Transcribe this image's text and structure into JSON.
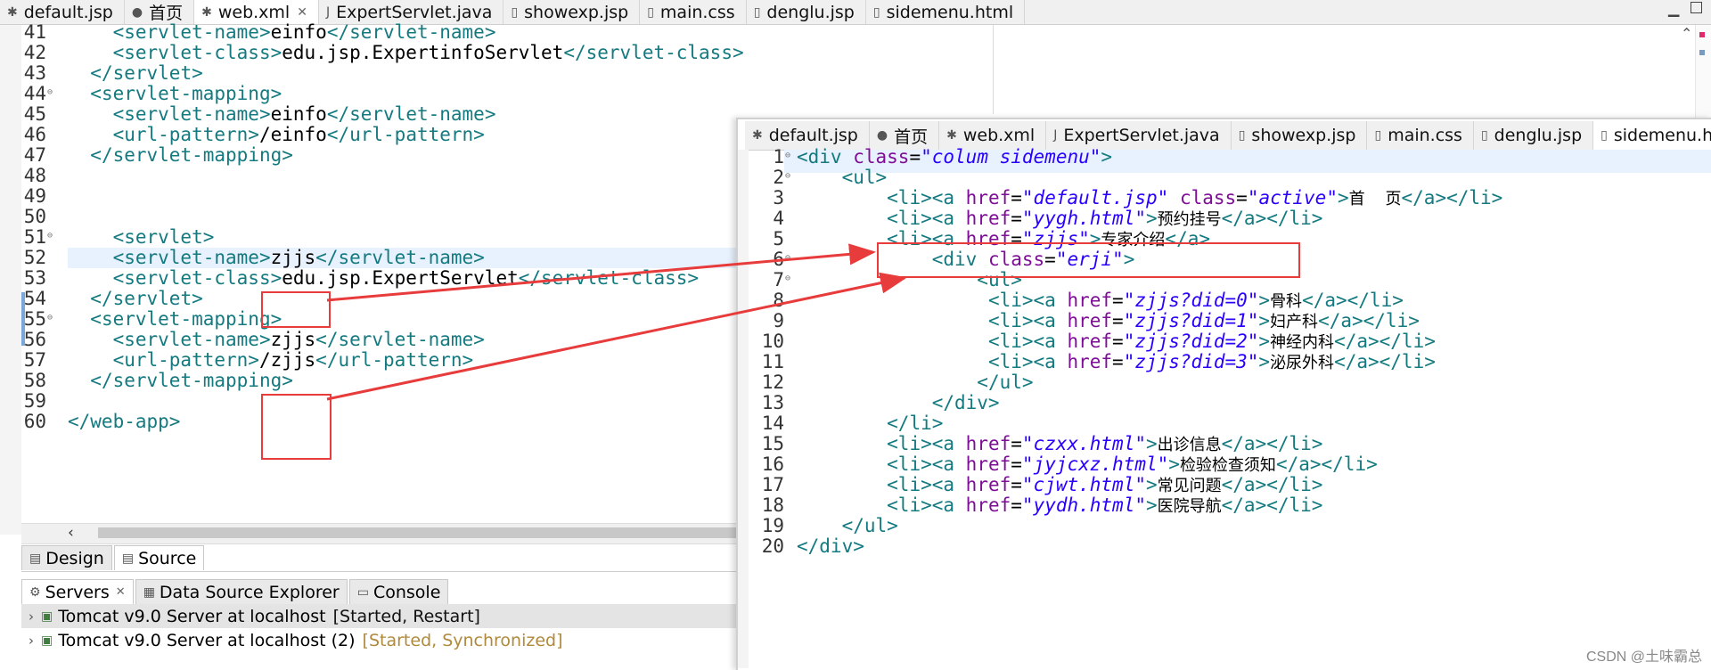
{
  "left_tabs": [
    {
      "icon": "xml-file-icon",
      "label": "default.jsp",
      "active": false
    },
    {
      "icon": "globe-icon",
      "label": "首页",
      "active": false
    },
    {
      "icon": "xml-file-icon",
      "label": "web.xml",
      "active": true,
      "close": "✕"
    },
    {
      "icon": "java-file-icon",
      "label": "ExpertServlet.java",
      "active": false
    },
    {
      "icon": "jsp-file-icon",
      "label": "showexp.jsp",
      "active": false
    },
    {
      "icon": "css-file-icon",
      "label": "main.css",
      "active": false
    },
    {
      "icon": "jsp-file-icon",
      "label": "denglu.jsp",
      "active": false
    },
    {
      "icon": "html-file-icon",
      "label": "sidemenu.html",
      "active": false
    }
  ],
  "left_code": [
    {
      "n": "41",
      "html": "    <span class='t'>&lt;servlet-name&gt;</span><span class='k'>einfo</span><span class='t'>&lt;/servlet-name&gt;</span>"
    },
    {
      "n": "42",
      "html": "    <span class='t'>&lt;servlet-class&gt;</span><span class='k'>edu.jsp.ExpertinfoServlet</span><span class='t'>&lt;/servlet-class&gt;</span>"
    },
    {
      "n": "43",
      "html": "  <span class='t'>&lt;/servlet&gt;</span>"
    },
    {
      "n": "44",
      "fold": true,
      "html": "  <span class='t'>&lt;servlet-mapping&gt;</span>"
    },
    {
      "n": "45",
      "html": "    <span class='t'>&lt;servlet-name&gt;</span><span class='k'>einfo</span><span class='t'>&lt;/servlet-name&gt;</span>"
    },
    {
      "n": "46",
      "html": "    <span class='t'>&lt;url-pattern&gt;</span><span class='k'>/einfo</span><span class='t'>&lt;/url-pattern&gt;</span>"
    },
    {
      "n": "47",
      "html": "  <span class='t'>&lt;/servlet-mapping&gt;</span>"
    },
    {
      "n": "48",
      "html": ""
    },
    {
      "n": "49",
      "html": ""
    },
    {
      "n": "50",
      "html": ""
    },
    {
      "n": "51",
      "fold": true,
      "html": "    <span class='t'>&lt;servlet&gt;</span>"
    },
    {
      "n": "52",
      "current": true,
      "html": "    <span class='t'>&lt;servlet-name&gt;</span><span class='k'>zjjs</span><span class='t'>&lt;/servlet-name&gt;</span>"
    },
    {
      "n": "53",
      "html": "    <span class='t'>&lt;servlet-class&gt;</span><span class='k'>edu.jsp.ExpertServlet</span><span class='t'>&lt;/servlet-class&gt;</span>"
    },
    {
      "n": "54",
      "html": "  <span class='t'>&lt;/servlet&gt;</span>"
    },
    {
      "n": "55",
      "fold": true,
      "html": "  <span class='t'>&lt;servlet-mapping&gt;</span>"
    },
    {
      "n": "56",
      "html": "    <span class='t'>&lt;servlet-name&gt;</span><span class='k'>zjjs</span><span class='t'>&lt;/servlet-name&gt;</span>"
    },
    {
      "n": "57",
      "html": "    <span class='t'>&lt;url-pattern&gt;</span><span class='k'>/zjjs</span><span class='t'>&lt;/url-pattern&gt;</span>"
    },
    {
      "n": "58",
      "html": "  <span class='t'>&lt;/servlet-mapping&gt;</span>"
    },
    {
      "n": "59",
      "html": ""
    },
    {
      "n": "60",
      "html": "<span class='t'>&lt;/web-app&gt;</span>"
    }
  ],
  "editor_mode_tabs": [
    {
      "icon": "design-icon",
      "label": "Design"
    },
    {
      "icon": "source-icon",
      "label": "Source"
    }
  ],
  "view_tabs": [
    {
      "icon": "servers-icon",
      "label": "Servers",
      "close": "✕"
    },
    {
      "icon": "database-icon",
      "label": "Data Source Explorer"
    },
    {
      "icon": "console-icon",
      "label": "Console"
    }
  ],
  "servers": [
    {
      "name": "Tomcat v9.0 Server at localhost",
      "status": "[Started, Restart]"
    },
    {
      "name": "Tomcat v9.0 Server at localhost (2)",
      "status": "[Started, Synchronized]"
    }
  ],
  "right_tabs": [
    {
      "icon": "xml-file-icon",
      "label": "default.jsp",
      "active": false
    },
    {
      "icon": "globe-icon",
      "label": "首页",
      "active": false
    },
    {
      "icon": "xml-file-icon",
      "label": "web.xml",
      "active": false
    },
    {
      "icon": "java-file-icon",
      "label": "ExpertServlet.java",
      "active": false
    },
    {
      "icon": "jsp-file-icon",
      "label": "showexp.jsp",
      "active": false
    },
    {
      "icon": "css-file-icon",
      "label": "main.css",
      "active": false
    },
    {
      "icon": "jsp-file-icon",
      "label": "denglu.jsp",
      "active": false
    },
    {
      "icon": "html-file-icon",
      "label": "sidemenu.ht",
      "active": true
    }
  ],
  "right_code": [
    {
      "n": "1",
      "fold": true,
      "html": "<span class='t'>&lt;div</span> <span class='a'>class</span>=<span class='v'>\"colum sidemenu\"</span><span class='t'>&gt;</span>"
    },
    {
      "n": "2",
      "fold": true,
      "html": "    <span class='t'>&lt;ul&gt;</span>"
    },
    {
      "n": "3",
      "html": "        <span class='t'>&lt;li&gt;&lt;a</span> <span class='a'>href</span>=<span class='v'>\"default.jsp\"</span> <span class='a'>class</span>=<span class='v'>\"active\"</span><span class='t'>&gt;</span><span class='cn'>首    页</span><span class='t'>&lt;/a&gt;&lt;/li&gt;</span>"
    },
    {
      "n": "4",
      "html": "        <span class='t'>&lt;li&gt;&lt;a</span> <span class='a'>href</span>=<span class='v'>\"yygh.html\"</span><span class='t'>&gt;</span><span class='cn'>预约挂号</span><span class='t'>&lt;/a&gt;&lt;/li&gt;</span>"
    },
    {
      "n": "5",
      "html": "        <span class='t'>&lt;li&gt;&lt;a</span> <span class='a'>href</span>=<span class='v'>\"zjjs\"</span><span class='t'>&gt;</span><span class='cn'>专家介绍</span><span class='t'>&lt;/a&gt;</span>"
    },
    {
      "n": "6",
      "fold": true,
      "html": "            <span class='t'>&lt;div</span> <span class='a'>class</span>=<span class='v'>\"erji\"</span><span class='t'>&gt;</span>"
    },
    {
      "n": "7",
      "fold": true,
      "html": "                <span class='t'>&lt;ul&gt;</span>"
    },
    {
      "n": "8",
      "html": "                 <span class='t'>&lt;li&gt;&lt;a</span> <span class='a'>href</span>=<span class='v'>\"zjjs?did=0\"</span><span class='t'>&gt;</span><span class='cn'>骨科</span><span class='t'>&lt;/a&gt;&lt;/li&gt;</span>"
    },
    {
      "n": "9",
      "html": "                 <span class='t'>&lt;li&gt;&lt;a</span> <span class='a'>href</span>=<span class='v'>\"zjjs?did=1\"</span><span class='t'>&gt;</span><span class='cn'>妇产科</span><span class='t'>&lt;/a&gt;&lt;/li&gt;</span>"
    },
    {
      "n": "10",
      "html": "                 <span class='t'>&lt;li&gt;&lt;a</span> <span class='a'>href</span>=<span class='v'>\"zjjs?did=2\"</span><span class='t'>&gt;</span><span class='cn'>神经内科</span><span class='t'>&lt;/a&gt;&lt;/li&gt;</span>"
    },
    {
      "n": "11",
      "html": "                 <span class='t'>&lt;li&gt;&lt;a</span> <span class='a'>href</span>=<span class='v'>\"zjjs?did=3\"</span><span class='t'>&gt;</span><span class='cn'>泌尿外科</span><span class='t'>&lt;/a&gt;&lt;/li&gt;</span>"
    },
    {
      "n": "12",
      "html": "                <span class='t'>&lt;/ul&gt;</span>"
    },
    {
      "n": "13",
      "html": "            <span class='t'>&lt;/div&gt;</span>"
    },
    {
      "n": "14",
      "html": "        <span class='t'>&lt;/li&gt;</span>"
    },
    {
      "n": "15",
      "html": "        <span class='t'>&lt;li&gt;&lt;a</span> <span class='a'>href</span>=<span class='v'>\"czxx.html\"</span><span class='t'>&gt;</span><span class='cn'>出诊信息</span><span class='t'>&lt;/a&gt;&lt;/li&gt;</span>"
    },
    {
      "n": "16",
      "html": "        <span class='t'>&lt;li&gt;&lt;a</span> <span class='a'>href</span>=<span class='v'>\"jyjcxz.html\"</span><span class='t'>&gt;</span><span class='cn'>检验检查须知</span><span class='t'>&lt;/a&gt;&lt;/li&gt;</span>"
    },
    {
      "n": "17",
      "html": "        <span class='t'>&lt;li&gt;&lt;a</span> <span class='a'>href</span>=<span class='v'>\"cjwt.html\"</span><span class='t'>&gt;</span><span class='cn'>常见问题</span><span class='t'>&lt;/a&gt;&lt;/li&gt;</span>"
    },
    {
      "n": "18",
      "html": "        <span class='t'>&lt;li&gt;&lt;a</span> <span class='a'>href</span>=<span class='v'>\"yydh.html\"</span><span class='t'>&gt;</span><span class='cn'>医院导航</span><span class='t'>&lt;/a&gt;&lt;/li&gt;</span>"
    },
    {
      "n": "19",
      "html": "    <span class='t'>&lt;/ul&gt;</span>"
    },
    {
      "n": "20",
      "html": "<span class='t'>&lt;/div&gt;</span>"
    }
  ],
  "watermark": "CSDN @土味霸总",
  "colors": {
    "accent": "#e83b3b",
    "tag": "#147a80",
    "attr": "#7e0e96",
    "value": "#2a00ff"
  }
}
